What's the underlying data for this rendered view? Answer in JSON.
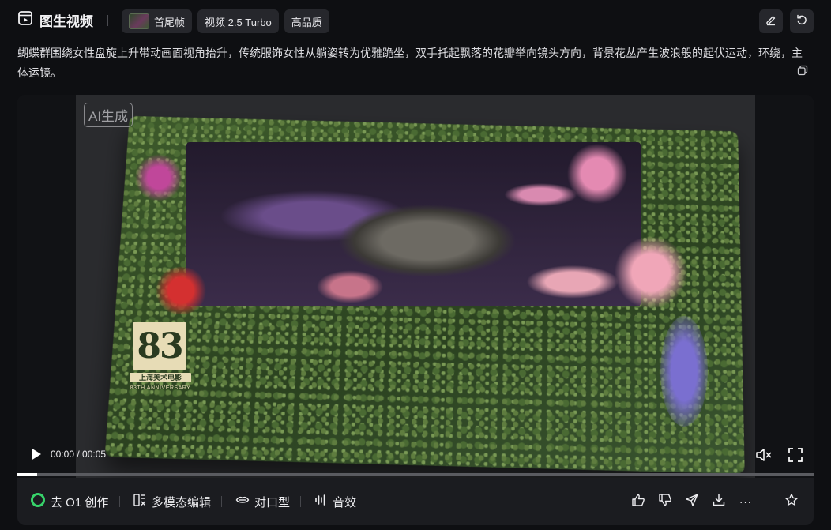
{
  "header": {
    "title": "图生视频",
    "chips": [
      "首尾帧",
      "视频 2.5 Turbo",
      "高品质"
    ]
  },
  "prompt": "蝴蝶群围绕女性盘旋上升带动画面视角抬升，传统服饰女性从躺姿转为优雅跪坐，双手托起飘落的花瓣举向镜头方向，背景花丛产生波浪般的起伏运动，环绕，主体运镜。",
  "player": {
    "watermark": "AI生成",
    "logo_number": "83",
    "logo_text": "上海美术电影",
    "logo_sub": "83TH ANNIVERSARY",
    "time": "00:00 / 00:05",
    "progress_percent": 2.5
  },
  "toolbar": {
    "o1": "去 O1 创作",
    "multi_edit": "多模态编辑",
    "lip_sync": "对口型",
    "sound": "音效",
    "more": "···"
  },
  "colors": {
    "accent_green": "#37d26a",
    "card_bg": "#1b1c20",
    "page_bg": "#0e0f12"
  }
}
